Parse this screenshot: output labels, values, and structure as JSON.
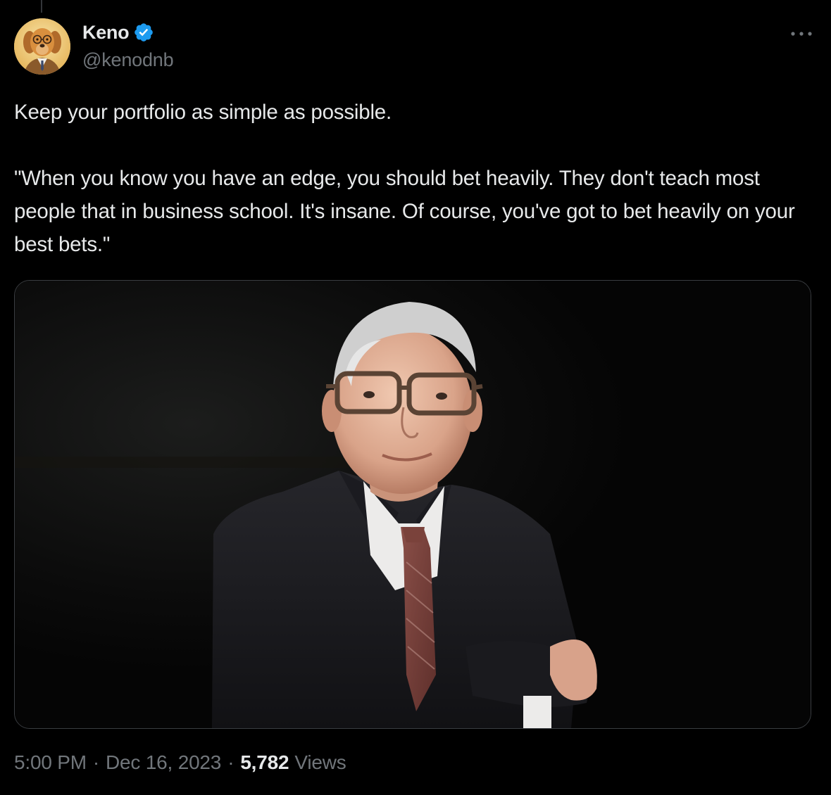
{
  "author": {
    "display_name": "Keno",
    "handle": "@kenodnb",
    "verified": true
  },
  "tweet": {
    "paragraphs": [
      "Keep your portfolio as simple as possible.",
      "\"When you know you have an edge, you should bet heavily. They don't teach most people that in business school. It's insane. Of course, you've got to bet heavily on your best bets.\""
    ]
  },
  "meta": {
    "time": "5:00 PM",
    "date": "Dec 16, 2023",
    "separator": "·",
    "views_count": "5,782",
    "views_label": "Views"
  },
  "icons": {
    "verified": "verified-badge-icon",
    "more": "more-options-icon"
  },
  "colors": {
    "background": "#000000",
    "text_primary": "#e7e9ea",
    "text_secondary": "#71767b",
    "verified_blue": "#1d9bf0",
    "border": "#3a3d41"
  }
}
